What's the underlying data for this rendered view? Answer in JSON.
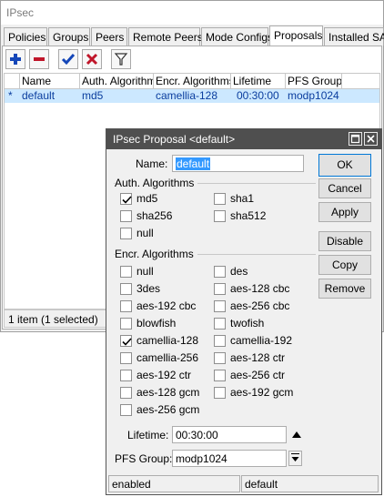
{
  "window": {
    "title": "IPsec"
  },
  "tabs": [
    {
      "label": "Policies",
      "active": false
    },
    {
      "label": "Groups",
      "active": false
    },
    {
      "label": "Peers",
      "active": false
    },
    {
      "label": "Remote Peers",
      "active": false
    },
    {
      "label": "Mode Configs",
      "active": false
    },
    {
      "label": "Proposals",
      "active": true
    },
    {
      "label": "Installed SAs",
      "active": false
    }
  ],
  "toolbar": {
    "buttons": [
      {
        "icon": "plus-icon",
        "color": "#1446b8"
      },
      {
        "icon": "minus-icon",
        "color": "#c0162a"
      },
      {
        "icon": "check-icon",
        "color": "#1446b8"
      },
      {
        "icon": "x-icon",
        "color": "#c0162a"
      },
      {
        "icon": "filter-icon",
        "color": "#333333"
      }
    ]
  },
  "table": {
    "columns": [
      "",
      "Name",
      "Auth. Algorithms",
      "Encr. Algorithms",
      "Lifetime",
      "PFS Group"
    ],
    "rows": [
      {
        "flag": "*",
        "name": "default",
        "auth": "md5",
        "encr": "camellia-128",
        "lifetime": "00:30:00",
        "pfs": "modp1024",
        "selected": true
      }
    ]
  },
  "status": {
    "text": "1 item (1 selected)"
  },
  "dialog": {
    "title": "IPsec Proposal <default>",
    "name_label": "Name:",
    "name_value": "default",
    "auth_section": "Auth. Algorithms",
    "auth_options": [
      {
        "label": "md5",
        "checked": true
      },
      {
        "label": "sha1",
        "checked": false
      },
      {
        "label": "sha256",
        "checked": false
      },
      {
        "label": "sha512",
        "checked": false
      },
      {
        "label": "null",
        "checked": false
      }
    ],
    "encr_section": "Encr. Algorithms",
    "encr_options": [
      {
        "label": "null",
        "checked": false
      },
      {
        "label": "des",
        "checked": false
      },
      {
        "label": "3des",
        "checked": false
      },
      {
        "label": "aes-128 cbc",
        "checked": false
      },
      {
        "label": "aes-192 cbc",
        "checked": false
      },
      {
        "label": "aes-256 cbc",
        "checked": false
      },
      {
        "label": "blowfish",
        "checked": false
      },
      {
        "label": "twofish",
        "checked": false
      },
      {
        "label": "camellia-128",
        "checked": true
      },
      {
        "label": "camellia-192",
        "checked": false
      },
      {
        "label": "camellia-256",
        "checked": false
      },
      {
        "label": "aes-128 ctr",
        "checked": false
      },
      {
        "label": "aes-192 ctr",
        "checked": false
      },
      {
        "label": "aes-256 ctr",
        "checked": false
      },
      {
        "label": "aes-128 gcm",
        "checked": false
      },
      {
        "label": "aes-192 gcm",
        "checked": false
      },
      {
        "label": "aes-256 gcm",
        "checked": false
      }
    ],
    "lifetime_label": "Lifetime:",
    "lifetime_value": "00:30:00",
    "pfs_label": "PFS Group:",
    "pfs_value": "modp1024",
    "buttons": {
      "ok": "OK",
      "cancel": "Cancel",
      "apply": "Apply",
      "disable": "Disable",
      "copy": "Copy",
      "remove": "Remove"
    },
    "status_left": "enabled",
    "status_right": "default"
  }
}
